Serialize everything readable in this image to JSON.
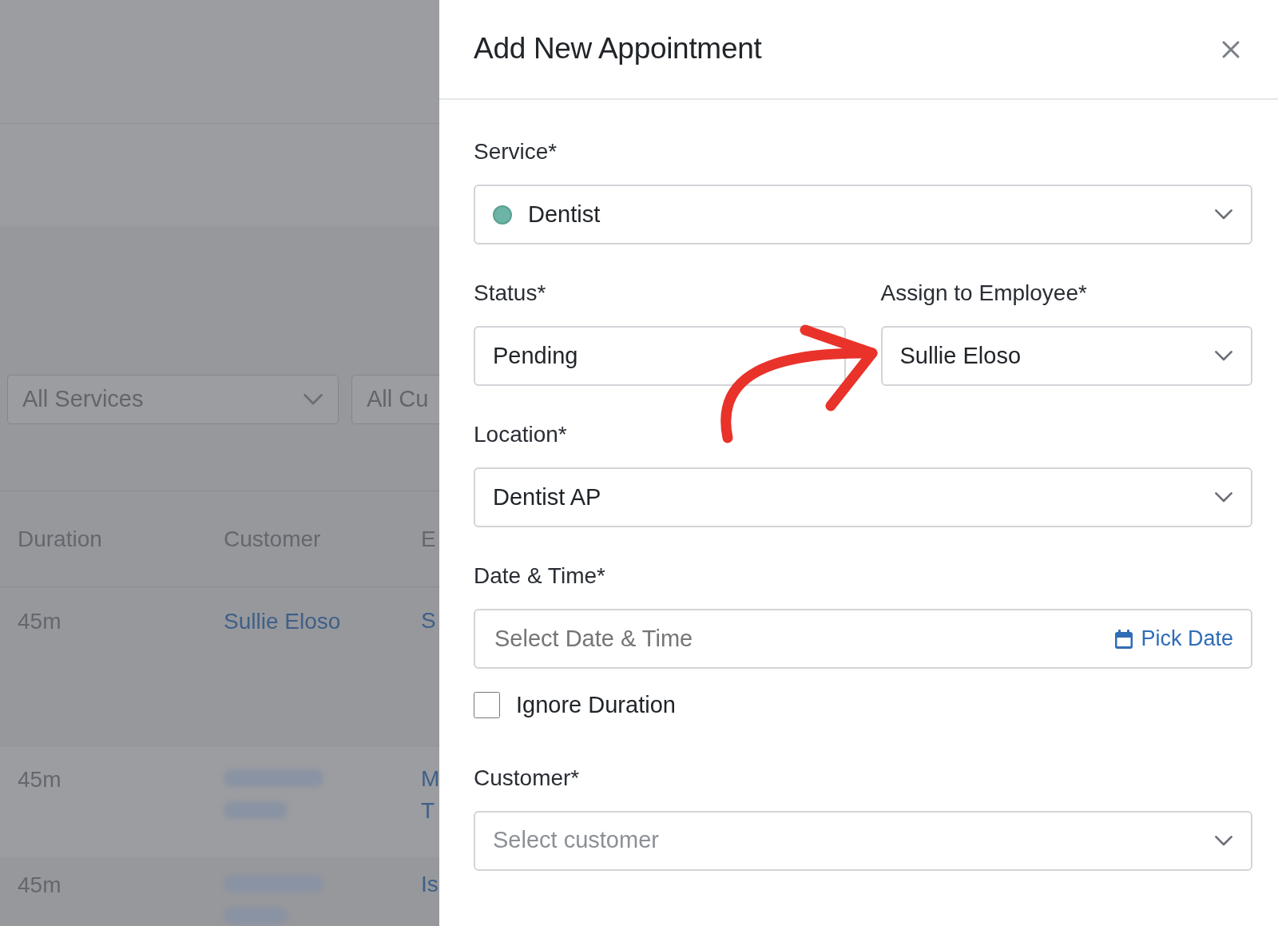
{
  "background": {
    "filters": [
      {
        "label": "All Services"
      },
      {
        "label": "All Cu"
      }
    ],
    "table": {
      "columns": [
        "Duration",
        "Customer",
        "E"
      ],
      "rows": [
        {
          "duration": "45m",
          "customer": [
            "Sullie Eloso"
          ],
          "redacted": false,
          "column_3": [
            "S"
          ]
        },
        {
          "duration": "45m",
          "customer": [],
          "redacted": true,
          "column_3": [
            "M",
            "T"
          ]
        },
        {
          "duration": "45m",
          "customer": [],
          "redacted": true,
          "column_3": [
            "Is"
          ]
        }
      ]
    }
  },
  "modal": {
    "title": "Add New Appointment",
    "service": {
      "label": "Service*",
      "value": "Dentist",
      "color": "#6cb5a6"
    },
    "status": {
      "label": "Status*",
      "value": "Pending"
    },
    "employee": {
      "label": "Assign to Employee*",
      "value": "Sullie Eloso"
    },
    "location": {
      "label": "Location*",
      "value": "Dentist AP"
    },
    "datetime": {
      "label": "Date & Time*",
      "placeholder": "Select Date & Time",
      "button": "Pick Date"
    },
    "ignore_duration": {
      "label": "Ignore Duration",
      "checked": false
    },
    "customer": {
      "label": "Customer*",
      "placeholder": "Select customer"
    }
  }
}
